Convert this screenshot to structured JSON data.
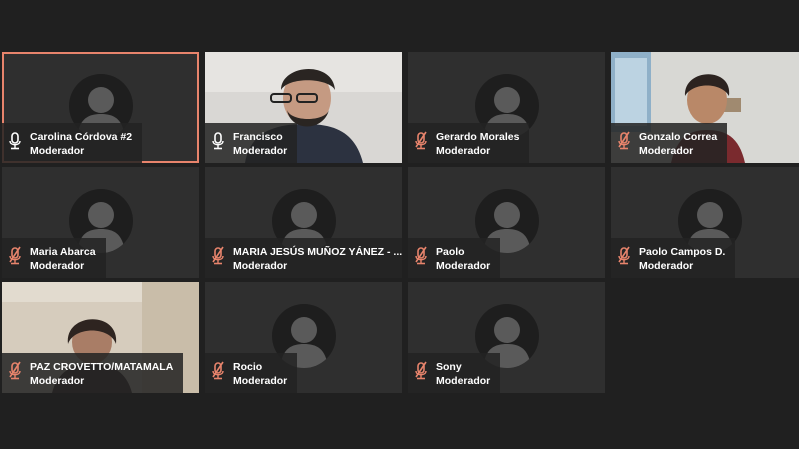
{
  "colors": {
    "accent": "#e8846c",
    "tile_bg": "#2f2f2f",
    "page_bg": "#202020"
  },
  "participants": [
    {
      "name": "Carolina Córdova #2",
      "role": "Moderador",
      "mic": "mic-on-icon",
      "video": false,
      "active": true
    },
    {
      "name": "Francisco",
      "role": "Moderador",
      "mic": "mic-on-icon",
      "video": true,
      "active": false
    },
    {
      "name": "Gerardo Morales",
      "role": "Moderador",
      "mic": "mic-muted-icon",
      "video": false,
      "active": false
    },
    {
      "name": "Gonzalo Correa",
      "role": "Moderador",
      "mic": "mic-muted-icon",
      "video": true,
      "active": false
    },
    {
      "name": "Maria Abarca",
      "role": "Moderador",
      "mic": "mic-muted-icon",
      "video": false,
      "active": false
    },
    {
      "name": "MARIA JESÚS MUÑOZ YÁNEZ - ...",
      "role": "Moderador",
      "mic": "mic-muted-icon",
      "video": false,
      "active": false
    },
    {
      "name": "Paolo",
      "role": "Moderador",
      "mic": "mic-muted-icon",
      "video": false,
      "active": false
    },
    {
      "name": "Paolo Campos D.",
      "role": "Moderador",
      "mic": "mic-muted-icon",
      "video": false,
      "active": false
    },
    {
      "name": "PAZ CROVETTO/MATAMALA",
      "role": "Moderador",
      "mic": "mic-muted-icon",
      "video": true,
      "active": false
    },
    {
      "name": "Rocio",
      "role": "Moderador",
      "mic": "mic-muted-icon",
      "video": false,
      "active": false
    },
    {
      "name": "Sony",
      "role": "Moderador",
      "mic": "mic-muted-icon",
      "video": false,
      "active": false
    }
  ]
}
